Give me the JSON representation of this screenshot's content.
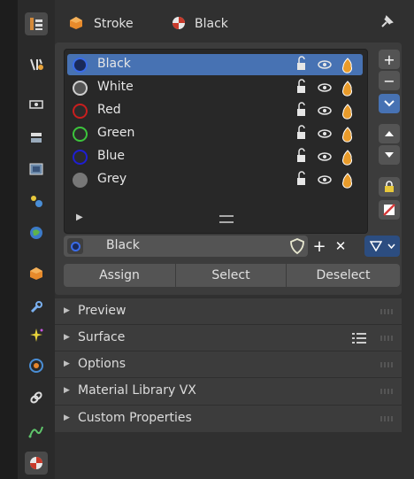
{
  "header": {
    "object_name": "Stroke",
    "material_name": "Black"
  },
  "materials": [
    {
      "label": "Black",
      "color": "#3a6be8",
      "selected": true
    },
    {
      "label": "White",
      "color": "#cfcfcf",
      "selected": false
    },
    {
      "label": "Red",
      "color": "#c81e1e",
      "selected": false
    },
    {
      "label": "Green",
      "color": "#3cc43c",
      "selected": false
    },
    {
      "label": "Blue",
      "color": "#1e1ed2",
      "selected": false
    },
    {
      "label": "Grey",
      "color": "#777777",
      "selected": false
    }
  ],
  "active_material": {
    "label": "Black"
  },
  "buttons": {
    "assign": "Assign",
    "select": "Select",
    "deselect": "Deselect"
  },
  "subpanels": [
    {
      "label": "Preview"
    },
    {
      "label": "Surface"
    },
    {
      "label": "Options"
    },
    {
      "label": "Material Library VX"
    },
    {
      "label": "Custom Properties"
    }
  ],
  "colors": {
    "accent": "#4772b3",
    "panel": "#3c3c3c",
    "background": "#303030"
  },
  "sidebar_icons": [
    "tool-icon",
    "render-icon",
    "output-icon",
    "view-layer-icon",
    "scene-icon",
    "world-icon",
    "collection-icon",
    "object-icon",
    "modifier-icon",
    "effects-icon",
    "physics-icon",
    "constraints-icon",
    "object-data-icon",
    "material-icon"
  ]
}
